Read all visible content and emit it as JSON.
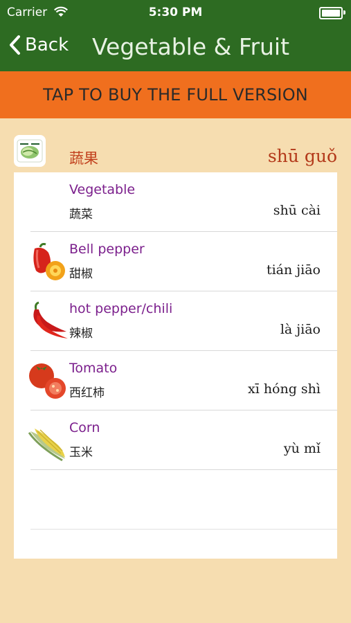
{
  "status": {
    "carrier": "Carrier",
    "time": "5:30 PM"
  },
  "nav": {
    "back_label": "Back",
    "title": "Vegetable & Fruit"
  },
  "banner": {
    "label": "TAP TO BUY THE FULL VERSION"
  },
  "category": {
    "chinese": "蔬果",
    "pinyin": "shū guǒ"
  },
  "items": [
    {
      "english": "Vegetable",
      "chinese": "蔬菜",
      "pinyin": "shū cài",
      "icon": "none"
    },
    {
      "english": "Bell pepper",
      "chinese": "甜椒",
      "pinyin": "tián jiāo",
      "icon": "bell-pepper-icon"
    },
    {
      "english": "hot pepper/chili",
      "chinese": "辣椒",
      "pinyin": "là jiāo",
      "icon": "chili-pepper-icon"
    },
    {
      "english": "Tomato",
      "chinese": "西红柿",
      "pinyin": "xī hóng shì",
      "icon": "tomato-icon"
    },
    {
      "english": "Corn",
      "chinese": "玉米",
      "pinyin": "yù mǐ",
      "icon": "corn-icon"
    }
  ],
  "colors": {
    "nav": "#2d6b22",
    "banner": "#f06f1e",
    "background": "#f6ddb0",
    "english_text": "#7b1f8c",
    "category_text": "#c1401d"
  }
}
